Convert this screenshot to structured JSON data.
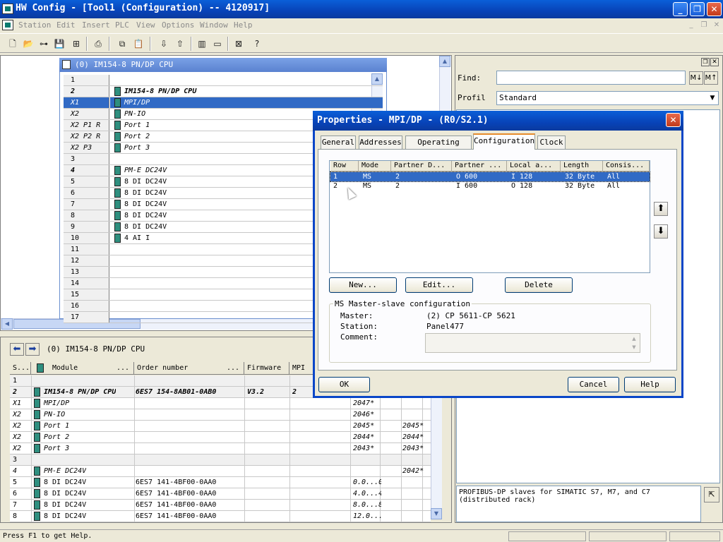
{
  "app": {
    "title": "HW Config - [Tool1 (Configuration) -- 4120917]",
    "menu": [
      "Station",
      "Edit",
      "Insert",
      "PLC",
      "View",
      "Options",
      "Window",
      "Help"
    ]
  },
  "station_rack": {
    "header": "(0) IM154-8 PN/DP CPU",
    "rows": [
      {
        "slot": "1",
        "module": ""
      },
      {
        "slot": "2",
        "module": "IM154-8 PN/DP CPU"
      },
      {
        "slot": "X1",
        "module": "MPI/DP"
      },
      {
        "slot": "X2",
        "module": "PN-IO"
      },
      {
        "slot": "X2 P1 R",
        "module": "Port 1"
      },
      {
        "slot": "X2 P2 R",
        "module": "Port 2"
      },
      {
        "slot": "X2 P3",
        "module": "Port 3"
      },
      {
        "slot": "3",
        "module": ""
      },
      {
        "slot": "4",
        "module": "PM-E DC24V"
      },
      {
        "slot": "5",
        "module": "8 DI DC24V"
      },
      {
        "slot": "6",
        "module": "8 DI DC24V"
      },
      {
        "slot": "7",
        "module": "8 DI DC24V"
      },
      {
        "slot": "8",
        "module": "8 DI DC24V"
      },
      {
        "slot": "9",
        "module": "8 DI DC24V"
      },
      {
        "slot": "10",
        "module": "4 AI I"
      },
      {
        "slot": "11",
        "module": ""
      },
      {
        "slot": "12",
        "module": ""
      },
      {
        "slot": "13",
        "module": ""
      },
      {
        "slot": "14",
        "module": ""
      },
      {
        "slot": "15",
        "module": ""
      },
      {
        "slot": "16",
        "module": ""
      },
      {
        "slot": "17",
        "module": ""
      }
    ]
  },
  "module_table": {
    "station_label": "(0)  IM154-8 PN/DP CPU",
    "columns": [
      "S...",
      "Module",
      "...",
      "Order number",
      "...",
      "Firmware",
      "MPI"
    ],
    "rows": [
      {
        "slot": "1",
        "module": "",
        "order": "",
        "fw": "",
        "mpi": "",
        "i": "",
        "q": ""
      },
      {
        "slot": "2",
        "module": "IM154-8 PN/DP CPU",
        "order": "6ES7 154-8AB01-0AB0",
        "fw": "V3.2",
        "mpi": "2",
        "i": "",
        "q": ""
      },
      {
        "slot": "X1",
        "module": "MPI/DP",
        "order": "",
        "fw": "",
        "mpi": "",
        "i": "2047*",
        "q": ""
      },
      {
        "slot": "X2",
        "module": "PN-IO",
        "order": "",
        "fw": "",
        "mpi": "",
        "i": "2046*",
        "q": ""
      },
      {
        "slot": "X2",
        "module": "Port 1",
        "order": "",
        "fw": "",
        "mpi": "",
        "i": "2045*",
        "q": "2045*"
      },
      {
        "slot": "X2",
        "module": "Port 2",
        "order": "",
        "fw": "",
        "mpi": "",
        "i": "2044*",
        "q": "2044*"
      },
      {
        "slot": "X2",
        "module": "Port 3",
        "order": "",
        "fw": "",
        "mpi": "",
        "i": "2043*",
        "q": "2043*"
      },
      {
        "slot": "3",
        "module": "",
        "order": "",
        "fw": "",
        "mpi": "",
        "i": "",
        "q": ""
      },
      {
        "slot": "4",
        "module": "PM-E DC24V",
        "order": "",
        "fw": "",
        "mpi": "",
        "i": "",
        "q": "2042*"
      },
      {
        "slot": "5",
        "module": "8 DI DC24V",
        "order": "6ES7 141-4BF00-0AA0",
        "fw": "",
        "mpi": "",
        "i": "0.0...0",
        "q": ""
      },
      {
        "slot": "6",
        "module": "8 DI DC24V",
        "order": "6ES7 141-4BF00-0AA0",
        "fw": "",
        "mpi": "",
        "i": "4.0...4",
        "q": ""
      },
      {
        "slot": "7",
        "module": "8 DI DC24V",
        "order": "6ES7 141-4BF00-0AA0",
        "fw": "",
        "mpi": "",
        "i": "8.0...8",
        "q": ""
      },
      {
        "slot": "8",
        "module": "8 DI DC24V",
        "order": "6ES7 141-4BF00-0AA0",
        "fw": "",
        "mpi": "",
        "i": "12.0...",
        "q": ""
      }
    ]
  },
  "catalog": {
    "find_label": "Find:",
    "find_value": "",
    "profile_label": "Profil",
    "profile_value": "Standard",
    "info": "PROFIBUS-DP slaves for SIMATIC S7, M7, and C7\n(distributed rack)"
  },
  "dialog": {
    "title": "Properties - MPI/DP - (R0/S2.1)",
    "tabs": [
      "General",
      "Addresses",
      "Operating Mode",
      "Configuration",
      "Clock"
    ],
    "active_tab": "Configuration",
    "columns": [
      "Row",
      "Mode",
      "Partner D...",
      "Partner ...",
      "Local a...",
      "Length",
      "Consis..."
    ],
    "rows": [
      {
        "row": "1",
        "mode": "MS",
        "pd": "2",
        "pa": "O 600",
        "la": "I 128",
        "len": "32 Byte",
        "cons": "All"
      },
      {
        "row": "2",
        "mode": "MS",
        "pd": "2",
        "pa": "I 600",
        "la": "O 128",
        "len": "32 Byte",
        "cons": "All"
      }
    ],
    "new_btn": "New...",
    "edit_btn": "Edit...",
    "delete_btn": "Delete",
    "group_title": "MS Master-slave configuration",
    "master_label": "Master:",
    "master_value": "(2) CP 5611-CP 5621",
    "station_label": "Station:",
    "station_value": "Panel477",
    "comment_label": "Comment:",
    "comment_value": "",
    "ok": "OK",
    "cancel": "Cancel",
    "help": "Help"
  },
  "status": {
    "text": "Press F1 to get Help."
  }
}
